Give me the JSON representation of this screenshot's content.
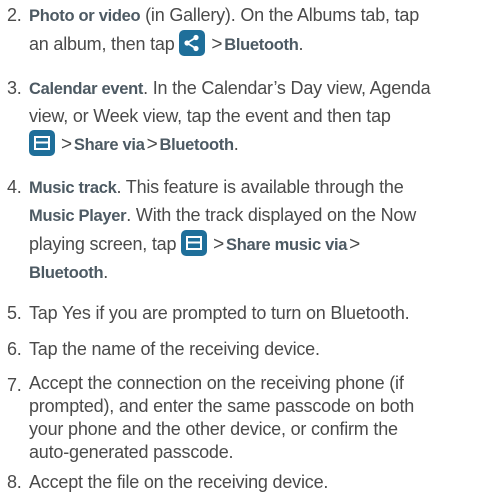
{
  "steps": [
    {
      "num": "2.",
      "title": "Photo or video",
      "l1_after_title": " (in Gallery). On the Albums tab, tap",
      "l2_text": "an album, then tap ",
      "share_icon": "share-icon",
      "gt": ">",
      "l2_bold": "Bluetooth",
      "l2_end": "."
    },
    {
      "num": "3.",
      "title": "Calendar event",
      "l1_after_title": ". In the Calendar’s Day view, Agenda",
      "l2": "view, or Week view, tap the event and then tap",
      "menu_icon": "menu-icon",
      "gt": ">",
      "bold1": "Share via",
      "bold2": "Bluetooth",
      "end": "."
    },
    {
      "num": "4.",
      "title": "Music track",
      "l1_after_title": ". This feature is available through the",
      "l2_bold": "Music Player",
      "l2_after": ". With the track displayed on the Now",
      "l3_text": "playing screen, tap ",
      "menu_icon": "menu-icon",
      "gt": ">",
      "l3_bold": "Share music via",
      "l4_bold": "Bluetooth",
      "end": "."
    },
    {
      "num": "5.",
      "text": "Tap Yes if you are prompted to turn on Bluetooth."
    },
    {
      "num": "6.",
      "text": "Tap the name of the receiving device."
    },
    {
      "num": "7.",
      "lines": [
        "Accept the connection on the receiving phone (if",
        "prompted), and enter the same passcode on both",
        "your phone and the other device, or confirm the",
        "auto-generated passcode."
      ]
    },
    {
      "num": "8.",
      "text": "Accept the file on the receiving device."
    }
  ]
}
